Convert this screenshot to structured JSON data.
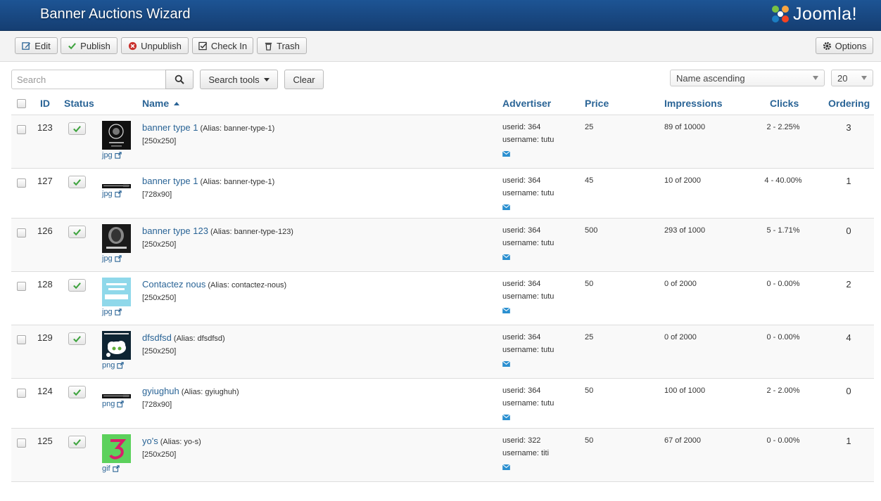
{
  "header": {
    "title": "Banner Auctions Wizard",
    "logo_text": "Joomla!"
  },
  "toolbar": {
    "edit": "Edit",
    "publish": "Publish",
    "unpublish": "Unpublish",
    "checkin": "Check In",
    "trash": "Trash",
    "options": "Options"
  },
  "filters": {
    "search_placeholder": "Search",
    "search_tools": "Search tools",
    "clear": "Clear",
    "sort": "Name ascending",
    "limit": "20"
  },
  "table": {
    "headers": {
      "id": "ID",
      "status": "Status",
      "name": "Name",
      "advertiser": "Advertiser",
      "price": "Price",
      "impressions": "Impressions",
      "clicks": "Clicks",
      "ordering": "Ordering"
    },
    "rows": [
      {
        "id": "123",
        "type": "jpg",
        "thumb": "dark-round",
        "name": "banner type 1",
        "alias": "(Alias: banner-type-1)",
        "size": "[250x250]",
        "userid": "userid: 364",
        "username": "username: tutu",
        "price": "25",
        "impressions": "89 of 10000",
        "clicks": "2 - 2.25%",
        "ordering": "3"
      },
      {
        "id": "127",
        "type": "jpg",
        "thumb": "strip",
        "name": "banner type 1",
        "alias": "(Alias: banner-type-1)",
        "size": "[728x90]",
        "userid": "userid: 364",
        "username": "username: tutu",
        "price": "45",
        "impressions": "10 of 2000",
        "clicks": "4 - 40.00%",
        "ordering": "1"
      },
      {
        "id": "126",
        "type": "jpg",
        "thumb": "dark-face",
        "name": "banner type 123",
        "alias": "(Alias: banner-type-123)",
        "size": "[250x250]",
        "userid": "userid: 364",
        "username": "username: tutu",
        "price": "500",
        "impressions": "293 of 1000",
        "clicks": "5 - 1.71%",
        "ordering": "0"
      },
      {
        "id": "128",
        "type": "jpg",
        "thumb": "twitter",
        "name": "Contactez nous",
        "alias": "(Alias: contactez-nous)",
        "size": "[250x250]",
        "userid": "userid: 364",
        "username": "username: tutu",
        "price": "50",
        "impressions": "0 of 2000",
        "clicks": "0 - 0.00%",
        "ordering": "2"
      },
      {
        "id": "129",
        "type": "png",
        "thumb": "cloud",
        "name": "dfsdfsd",
        "alias": "(Alias: dfsdfsd)",
        "size": "[250x250]",
        "userid": "userid: 364",
        "username": "username: tutu",
        "price": "25",
        "impressions": "0 of 2000",
        "clicks": "0 - 0.00%",
        "ordering": "4"
      },
      {
        "id": "124",
        "type": "png",
        "thumb": "strip",
        "name": "gyiughuh",
        "alias": "(Alias: gyiughuh)",
        "size": "[728x90]",
        "userid": "userid: 364",
        "username": "username: tutu",
        "price": "50",
        "impressions": "100 of 1000",
        "clicks": "2 - 2.00%",
        "ordering": "0"
      },
      {
        "id": "125",
        "type": "gif",
        "thumb": "green-3",
        "name": "yo's",
        "alias": "(Alias: yo-s)",
        "size": "[250x250]",
        "userid": "userid: 322",
        "username": "username: titi",
        "price": "50",
        "impressions": "67 of 2000",
        "clicks": "0 - 0.00%",
        "ordering": "1"
      }
    ]
  },
  "colors": {
    "header": "#1d5494",
    "link": "#2a6496",
    "check_green": "#3ea33e"
  }
}
